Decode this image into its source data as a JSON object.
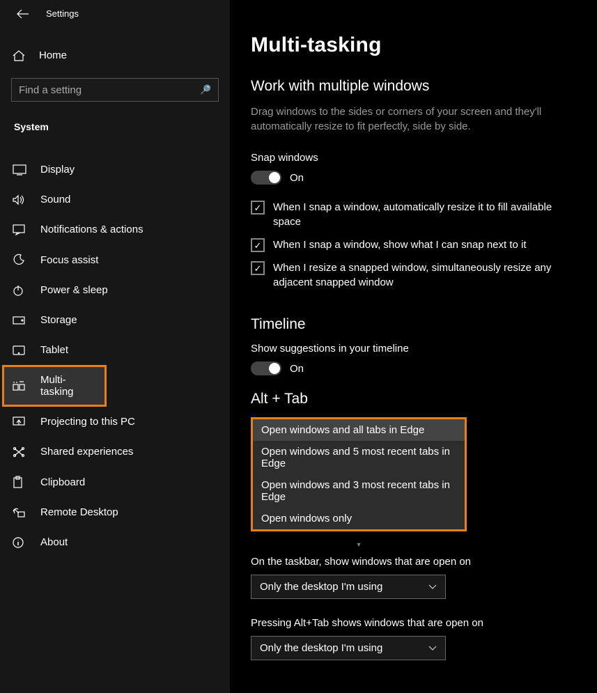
{
  "app_title": "Settings",
  "home_label": "Home",
  "search_placeholder": "Find a setting",
  "category": "System",
  "sidebar": {
    "items": [
      {
        "label": "Display"
      },
      {
        "label": "Sound"
      },
      {
        "label": "Notifications & actions"
      },
      {
        "label": "Focus assist"
      },
      {
        "label": "Power & sleep"
      },
      {
        "label": "Storage"
      },
      {
        "label": "Tablet"
      },
      {
        "label": "Multi-tasking"
      },
      {
        "label": "Projecting to this PC"
      },
      {
        "label": "Shared experiences"
      },
      {
        "label": "Clipboard"
      },
      {
        "label": "Remote Desktop"
      },
      {
        "label": "About"
      }
    ]
  },
  "page_title": "Multi-tasking",
  "s1": {
    "title": "Work with multiple windows",
    "desc": "Drag windows to the sides or corners of your screen and they'll automatically resize to fit perfectly, side by side.",
    "snap_label": "Snap windows",
    "snap_state": "On",
    "c1": "When I snap a window, automatically resize it to fill available space",
    "c2": "When I snap a window, show what I can snap next to it",
    "c3": "When I resize a snapped window, simultaneously resize any adjacent snapped window"
  },
  "s2": {
    "title": "Timeline",
    "label": "Show suggestions in your timeline",
    "state": "On"
  },
  "s3": {
    "title": "Alt + Tab",
    "options": [
      "Open windows and all tabs in Edge",
      "Open windows and 5 most recent tabs in Edge",
      "Open windows and 3 most recent tabs in Edge",
      "Open windows only"
    ]
  },
  "vd": {
    "label1": "On the taskbar, show windows that are open on",
    "value1": "Only the desktop I'm using",
    "label2": "Pressing Alt+Tab shows windows that are open on",
    "value2": "Only the desktop I'm using"
  }
}
